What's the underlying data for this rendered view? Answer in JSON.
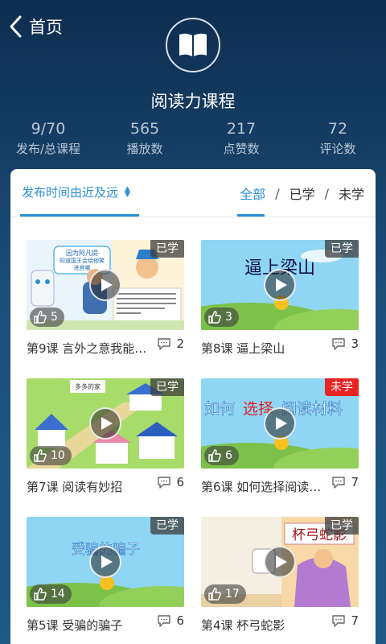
{
  "header": {
    "back_label": "首页",
    "course_title": "阅读力课程"
  },
  "stats": [
    {
      "value": "9/70",
      "label": "发布/总课程"
    },
    {
      "value": "565",
      "label": "播放数"
    },
    {
      "value": "217",
      "label": "点赞数"
    },
    {
      "value": "72",
      "label": "评论数"
    }
  ],
  "filters": {
    "sort_label": "发布时间由近及远",
    "tabs": [
      "全部",
      "已学",
      "未学"
    ],
    "active_tab": "全部"
  },
  "lessons": [
    {
      "title": "第9课  言外之意我能…",
      "status": "已学",
      "likes": "5",
      "comments": "2",
      "thumb_text": [
        "因为阿凡提",
        "知道国王会给他笑",
        "进宫哪"
      ]
    },
    {
      "title": "第8课  逼上梁山",
      "status": "已学",
      "likes": "3",
      "comments": "3",
      "thumb_text": [
        "逼上梁山"
      ]
    },
    {
      "title": "第7课  阅读有妙招",
      "status": "已学",
      "likes": "10",
      "comments": "6",
      "thumb_text": [
        "多多的家"
      ]
    },
    {
      "title": "第6课  如何选择阅读…",
      "status": "未学",
      "likes": "6",
      "comments": "7",
      "thumb_text": [
        "如何",
        "选择",
        "阅读材料"
      ]
    },
    {
      "title": "第5课  受骗的骗子",
      "status": "已学",
      "likes": "14",
      "comments": "6",
      "thumb_text": [
        "受骗的骗子"
      ]
    },
    {
      "title": "第4课  杯弓蛇影",
      "status": "已学",
      "likes": "17",
      "comments": "7",
      "thumb_text": [
        "杯弓蛇影"
      ]
    }
  ],
  "colors": {
    "accent": "#2b8fd8",
    "badge_learned": "#555555",
    "badge_unlearned": "#e82323"
  }
}
